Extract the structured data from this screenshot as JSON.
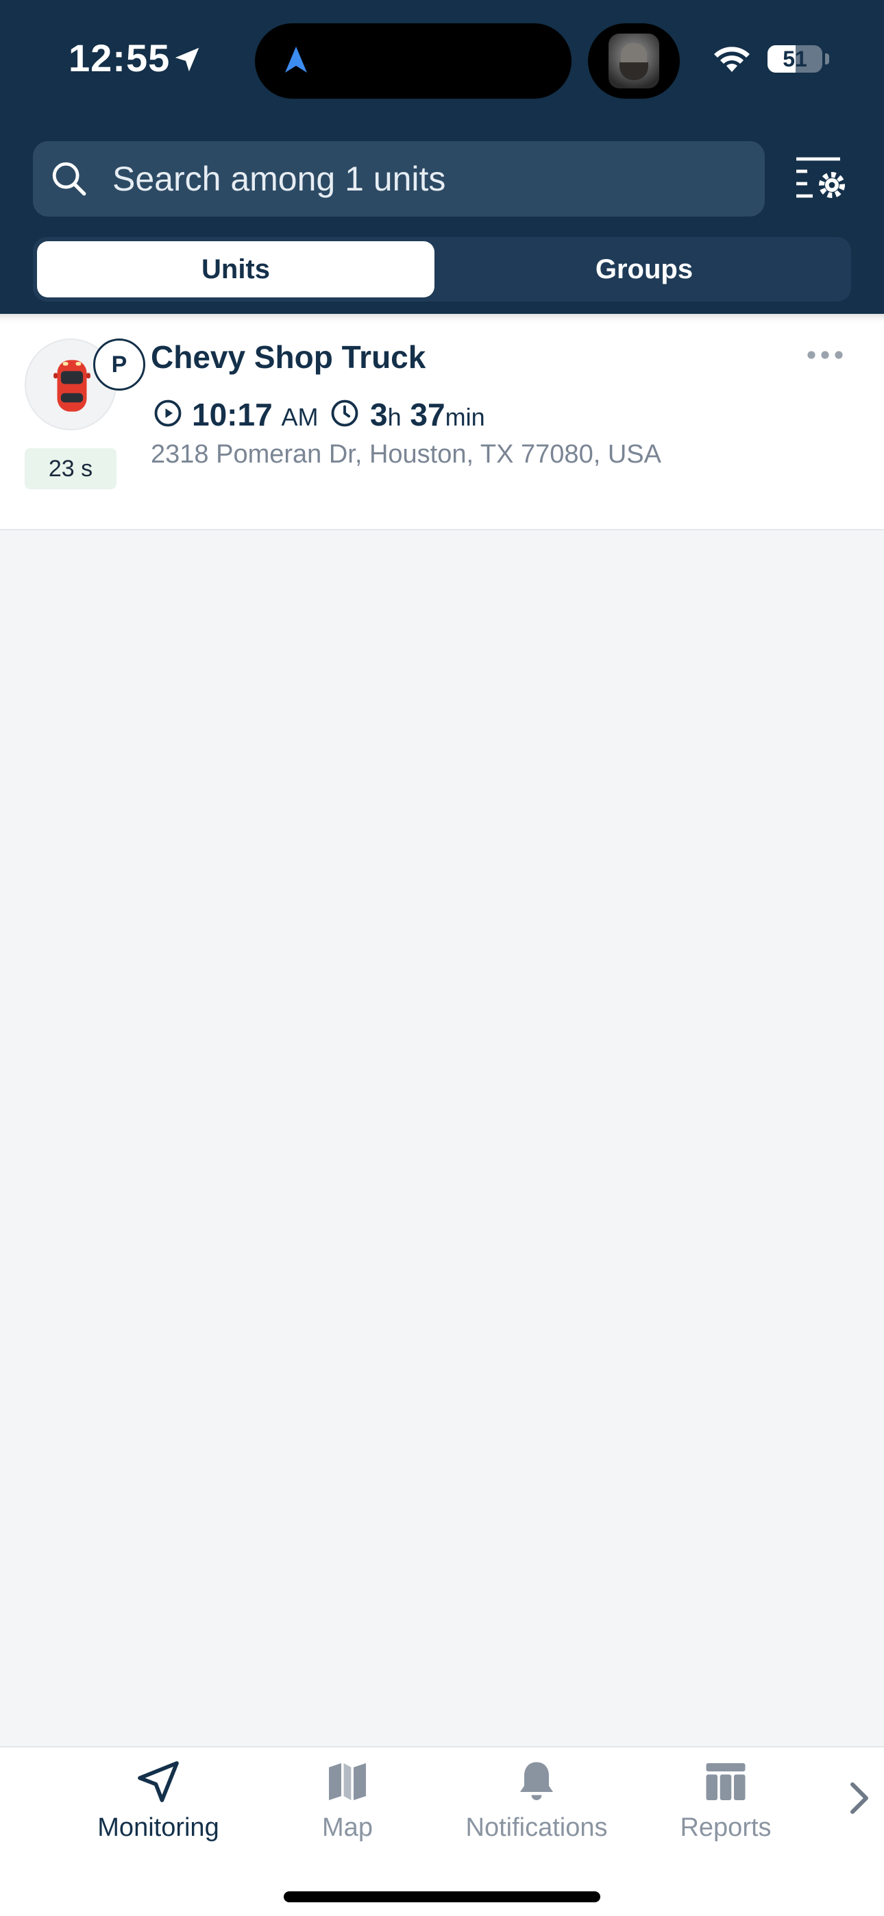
{
  "status_bar": {
    "time": "12:55",
    "battery": "51",
    "battery_level": 0.51
  },
  "search": {
    "placeholder": "Search among 1 units",
    "value": ""
  },
  "segments": {
    "units": "Units",
    "groups": "Groups",
    "selected": "Units"
  },
  "unit": {
    "name": "Chevy Shop Truck",
    "status_letter": "P",
    "last_update": "23 s",
    "time_value": "10:17",
    "time_ampm": "AM",
    "duration_hours": "3",
    "duration_hours_unit": "h",
    "duration_minutes": "37",
    "duration_minutes_unit": "min",
    "address": "2318 Pomeran Dr, Houston, TX 77080, USA",
    "icon": "car-icon"
  },
  "tabs": [
    {
      "label": "Monitoring",
      "icon": "navigation-arrow-icon",
      "active": true
    },
    {
      "label": "Map",
      "icon": "map-icon",
      "active": false
    },
    {
      "label": "Notifications",
      "icon": "bell-icon",
      "active": false
    },
    {
      "label": "Reports",
      "icon": "table-icon",
      "active": false
    }
  ],
  "colors": {
    "header": "#14304a",
    "accent": "#14304a",
    "inactive_tab": "#8a94a1",
    "badge_bg": "#e9f4ec"
  }
}
